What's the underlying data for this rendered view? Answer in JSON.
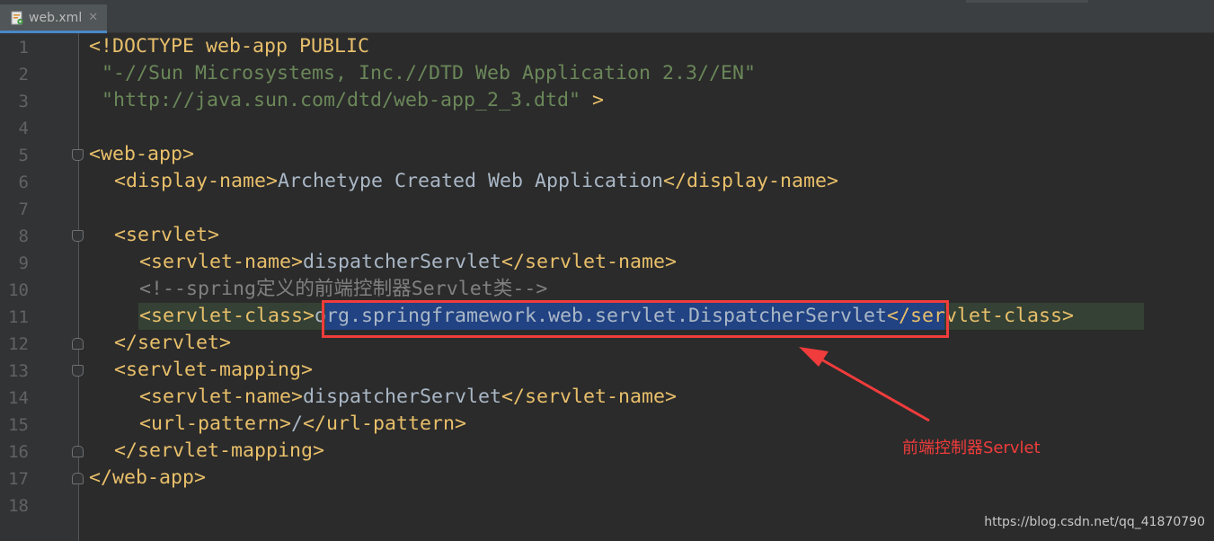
{
  "tab": {
    "filename": "web.xml",
    "close_glyph": "✕"
  },
  "gutter": {
    "line_numbers": [
      "1",
      "2",
      "3",
      "4",
      "5",
      "6",
      "7",
      "8",
      "9",
      "10",
      "11",
      "12",
      "13",
      "14",
      "15",
      "16",
      "17",
      "18"
    ]
  },
  "code": {
    "line1": {
      "doctype": "<!DOCTYPE web-app PUBLIC"
    },
    "line2": {
      "public_id": "\"-//Sun Microsystems, Inc.//DTD Web Application 2.3//EN\""
    },
    "line3": {
      "system_id": "\"http://java.sun.com/dtd/web-app_2_3.dtd\"",
      "close": " >"
    },
    "line5": {
      "open": "<web-app>"
    },
    "line6": {
      "open": "<display-name>",
      "text": "Archetype Created Web Application",
      "close": "</display-name>"
    },
    "line8": {
      "open": "<servlet>"
    },
    "line9": {
      "open": "<servlet-name>",
      "text": "dispatcherServlet",
      "close": "</servlet-name>"
    },
    "line10": {
      "comment": "<!--spring定义的前端控制器Servlet类-->"
    },
    "line11": {
      "open": "<servlet-class>",
      "text": "org.springframework.web.servlet.DispatcherServlet",
      "close": "</servlet-class>"
    },
    "line12": {
      "close": "</servlet>"
    },
    "line13": {
      "open": "<servlet-mapping>"
    },
    "line14": {
      "open": "<servlet-name>",
      "text": "dispatcherServlet",
      "close": "</servlet-name>"
    },
    "line15": {
      "open": "<url-pattern>",
      "text": "/",
      "close": "</url-pattern>"
    },
    "line16": {
      "close": "</servlet-mapping>"
    },
    "line17": {
      "close": "</web-app>"
    }
  },
  "annotation": {
    "label": "前端控制器Servlet",
    "color": "#f03c3c"
  },
  "watermark": "https://blog.csdn.net/qq_41870790",
  "colors": {
    "background": "#2b2b2b",
    "gutter": "#313335",
    "tag": "#e8bf6a",
    "string": "#6a8759",
    "comment": "#808080",
    "text": "#a9b7c6",
    "selection": "#214283",
    "line_highlight": "#344134"
  }
}
